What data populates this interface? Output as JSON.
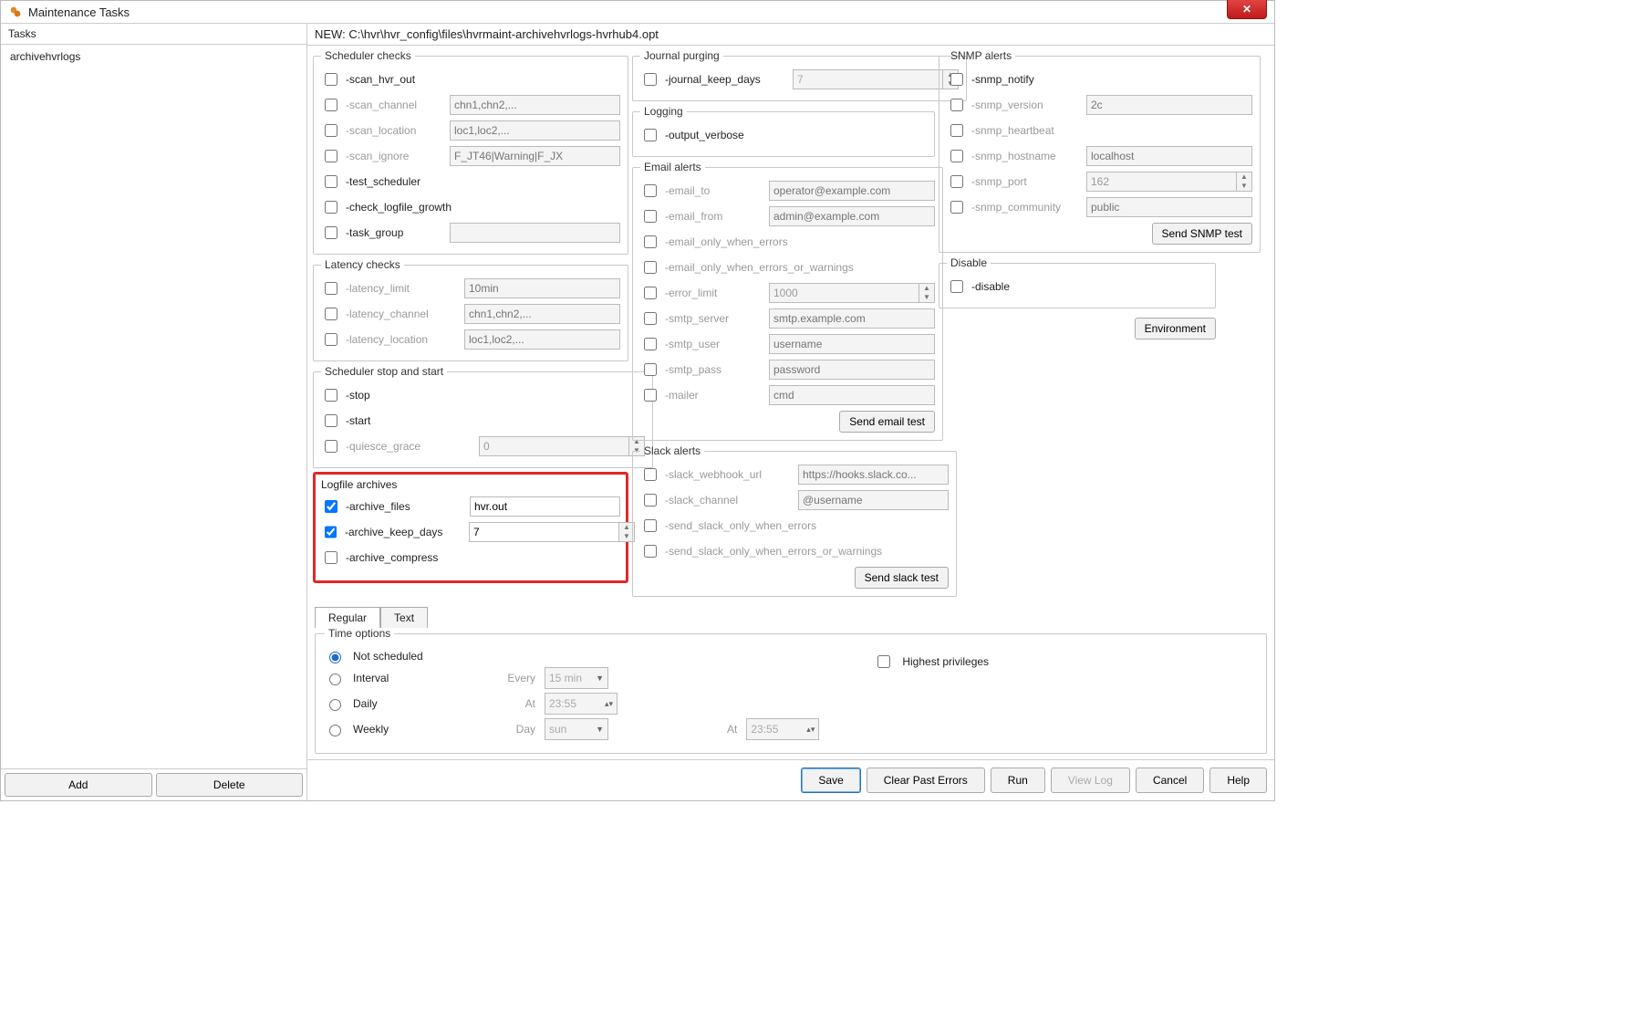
{
  "window": {
    "title": "Maintenance Tasks"
  },
  "tasks": {
    "header": "Tasks",
    "items": [
      "archivehvrlogs"
    ],
    "add": "Add",
    "delete": "Delete"
  },
  "path": "NEW: C:\\hvr\\hvr_config\\files\\hvrmaint-archivehvrlogs-hvrhub4.opt",
  "scheduler_checks": {
    "legend": "Scheduler checks",
    "scan_hvr_out": "-scan_hvr_out",
    "scan_channel": "-scan_channel",
    "scan_channel_ph": "chn1,chn2,...",
    "scan_location": "-scan_location",
    "scan_location_ph": "loc1,loc2,...",
    "scan_ignore": "-scan_ignore",
    "scan_ignore_ph": "F_JT46|Warning|F_JX",
    "test_scheduler": "-test_scheduler",
    "check_logfile_growth": "-check_logfile_growth",
    "task_group": "-task_group"
  },
  "latency_checks": {
    "legend": "Latency checks",
    "latency_limit": "-latency_limit",
    "latency_limit_ph": "10min",
    "latency_channel": "-latency_channel",
    "latency_channel_ph": "chn1,chn2,...",
    "latency_location": "-latency_location",
    "latency_location_ph": "loc1,loc2,..."
  },
  "sched_stop_start": {
    "legend": "Scheduler stop and start",
    "stop": "-stop",
    "start": "-start",
    "quiesce_grace": "-quiesce_grace",
    "quiesce_val": "0"
  },
  "logfile_archives": {
    "legend": "Logfile archives",
    "archive_files": "-archive_files",
    "archive_files_val": "hvr.out",
    "archive_keep_days": "-archive_keep_days",
    "archive_keep_days_val": "7",
    "archive_compress": "-archive_compress"
  },
  "journal_purging": {
    "legend": "Journal purging",
    "journal_keep_days": "-journal_keep_days",
    "journal_keep_days_val": "7"
  },
  "logging": {
    "legend": "Logging",
    "output_verbose": "-output_verbose"
  },
  "email_alerts": {
    "legend": "Email alerts",
    "email_to": "-email_to",
    "email_to_ph": "operator@example.com",
    "email_from": "-email_from",
    "email_from_ph": "admin@example.com",
    "email_only_errors": "-email_only_when_errors",
    "email_only_errors_warn": "-email_only_when_errors_or_warnings",
    "error_limit": "-error_limit",
    "error_limit_val": "1000",
    "smtp_server": "-smtp_server",
    "smtp_server_ph": "smtp.example.com",
    "smtp_user": "-smtp_user",
    "smtp_user_ph": "username",
    "smtp_pass": "-smtp_pass",
    "smtp_pass_ph": "password",
    "mailer": "-mailer",
    "mailer_ph": "cmd",
    "send_test": "Send email test"
  },
  "slack_alerts": {
    "legend": "Slack alerts",
    "webhook": "-slack_webhook_url",
    "webhook_ph": "https://hooks.slack.co...",
    "channel": "-slack_channel",
    "channel_ph": "@username",
    "only_errors": "-send_slack_only_when_errors",
    "only_errors_warn": "-send_slack_only_when_errors_or_warnings",
    "send_test": "Send slack test"
  },
  "snmp_alerts": {
    "legend": "SNMP alerts",
    "notify": "-snmp_notify",
    "version": "-snmp_version",
    "version_ph": "2c",
    "heartbeat": "-snmp_heartbeat",
    "hostname": "-snmp_hostname",
    "hostname_ph": "localhost",
    "port": "-snmp_port",
    "port_val": "162",
    "community": "-snmp_community",
    "community_ph": "public",
    "send_test": "Send SNMP test"
  },
  "disable": {
    "legend": "Disable",
    "disable_opt": "-disable"
  },
  "environment_btn": "Environment",
  "tabs": {
    "regular": "Regular",
    "text": "Text"
  },
  "time_options": {
    "legend": "Time options",
    "not_scheduled": "Not scheduled",
    "interval": "Interval",
    "every": "Every",
    "every_val": "15 min",
    "daily": "Daily",
    "at": "At",
    "at_val": "23:55",
    "weekly": "Weekly",
    "day": "Day",
    "day_val": "sun",
    "at2": "At",
    "at2_val": "23:55",
    "highest_priv": "Highest privileges"
  },
  "bottom_buttons": {
    "save": "Save",
    "clear_past_errors": "Clear Past Errors",
    "run": "Run",
    "view_log": "View Log",
    "cancel": "Cancel",
    "help": "Help"
  }
}
